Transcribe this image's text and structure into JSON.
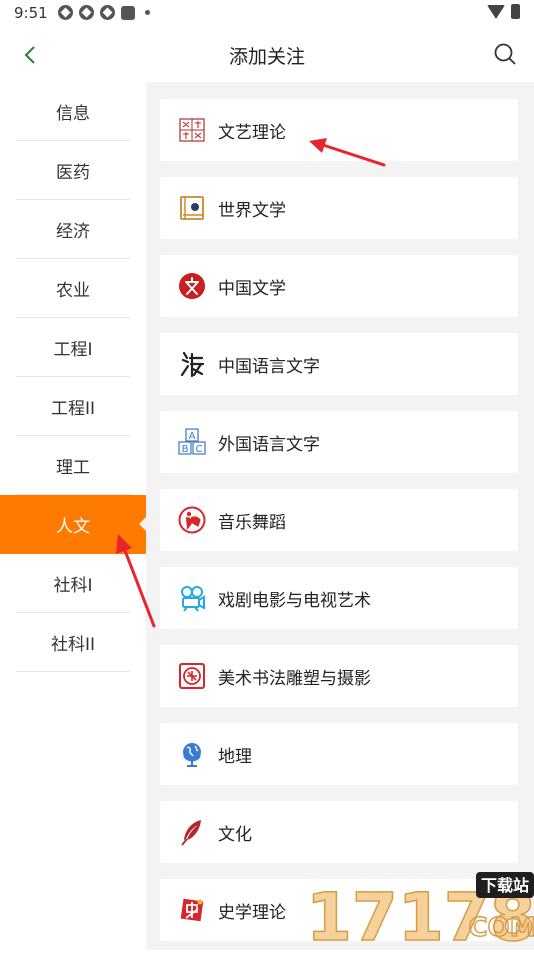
{
  "status": {
    "time": "9:51"
  },
  "header": {
    "title": "添加关注"
  },
  "sidebar": {
    "items": [
      {
        "label": "信息"
      },
      {
        "label": "医药"
      },
      {
        "label": "经济"
      },
      {
        "label": "农业"
      },
      {
        "label": "工程I"
      },
      {
        "label": "工程II"
      },
      {
        "label": "理工"
      },
      {
        "label": "人文",
        "active": true
      },
      {
        "label": "社科I"
      },
      {
        "label": "社科II"
      }
    ]
  },
  "content": {
    "cards": [
      {
        "label": "文艺理论",
        "icon": "literary-theory-seal-icon"
      },
      {
        "label": "世界文学",
        "icon": "world-literature-book-icon"
      },
      {
        "label": "中国文学",
        "icon": "chinese-literature-icon"
      },
      {
        "label": "中国语言文字",
        "icon": "chinese-language-glyph-icon"
      },
      {
        "label": "外国语言文字",
        "icon": "alphabet-blocks-icon"
      },
      {
        "label": "音乐舞蹈",
        "icon": "dance-icon"
      },
      {
        "label": "戏剧电影与电视艺术",
        "icon": "film-camera-icon"
      },
      {
        "label": "美术书法雕塑与摄影",
        "icon": "fine-arts-icon"
      },
      {
        "label": "地理",
        "icon": "globe-icon"
      },
      {
        "label": "文化",
        "icon": "feather-icon"
      },
      {
        "label": "史学理论",
        "icon": "history-theory-icon"
      }
    ]
  },
  "watermark": {
    "number": "17178",
    "site_text": "下载站",
    "domain": "COM"
  },
  "colors": {
    "accent": "#ff7a00",
    "arrow": "#e8252d",
    "background": "#f3f3f3"
  }
}
